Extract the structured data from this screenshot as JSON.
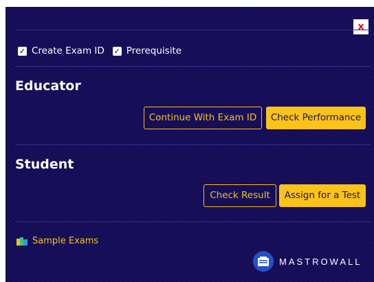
{
  "close_label": "x",
  "options": [
    {
      "label": "Create Exam ID",
      "checked": true
    },
    {
      "label": "Prerequisite",
      "checked": true
    }
  ],
  "educator": {
    "title": "Educator",
    "continue_label": "Continue With Exam ID",
    "performance_label": "Check Performance"
  },
  "student": {
    "title": "Student",
    "result_label": "Check Result",
    "assign_label": "Assign for a Test"
  },
  "sample_link": "Sample Exams",
  "brand": "MASTROWALL",
  "colors": {
    "background": "#150c57",
    "accent": "#fbc318",
    "divider": "#3e2a8c",
    "close": "#e01010",
    "brand_logo": "#2451c4"
  }
}
